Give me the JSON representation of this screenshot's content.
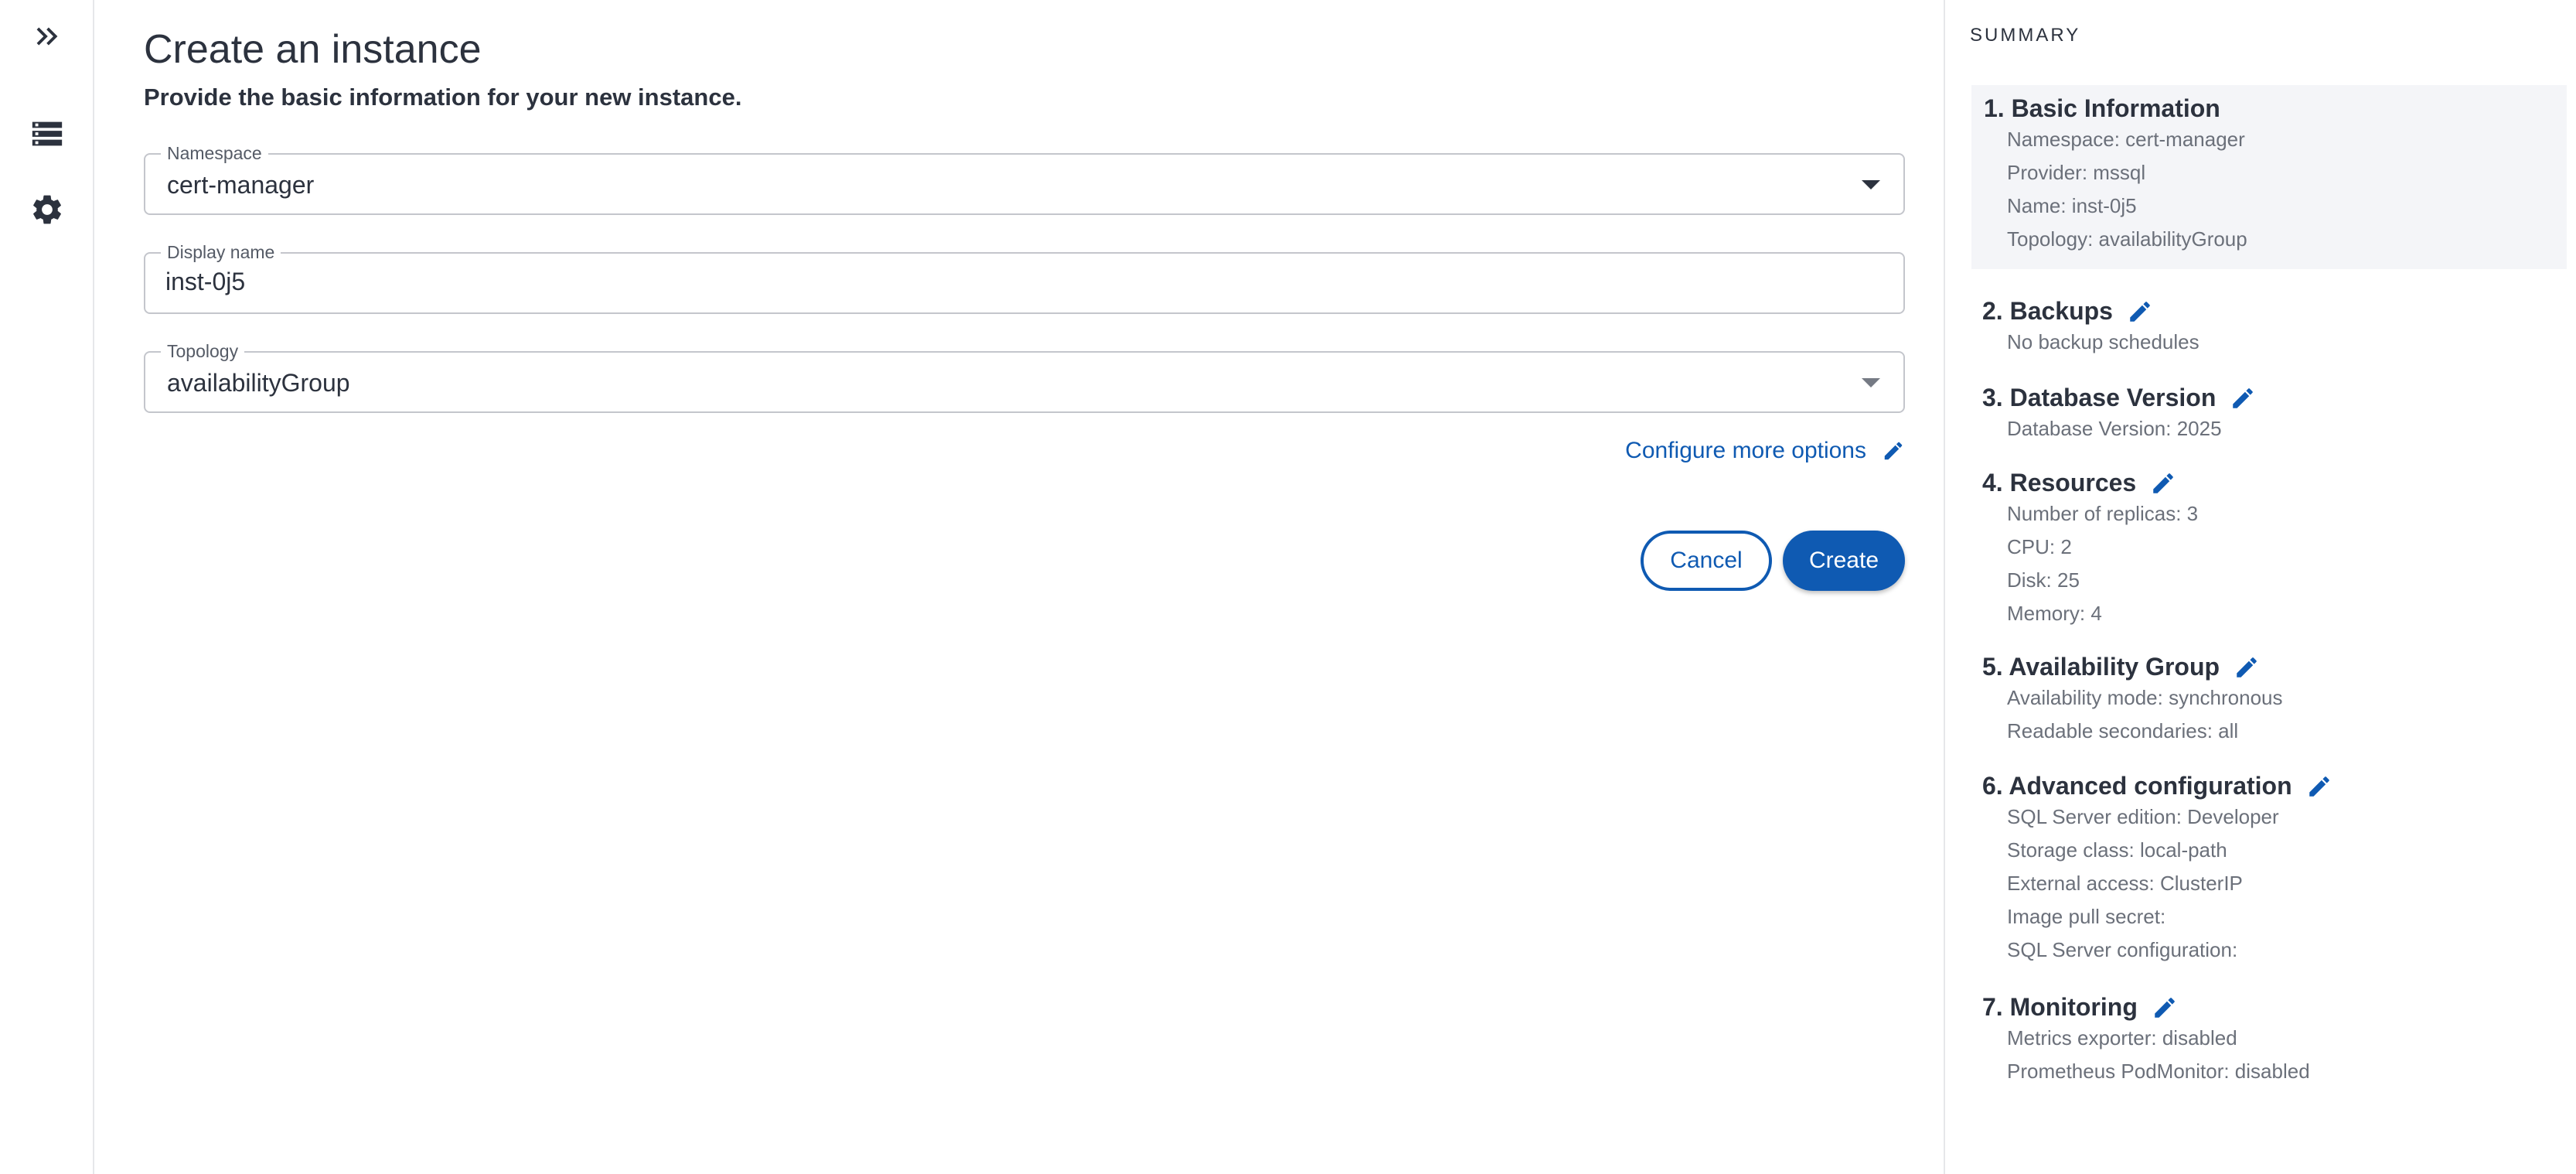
{
  "rail": {
    "icons": [
      "expand-icon",
      "list-icon",
      "gear-icon"
    ]
  },
  "form": {
    "title": "Create an instance",
    "subtitle": "Provide the basic information for your new instance.",
    "namespace": {
      "label": "Namespace",
      "value": "cert-manager"
    },
    "display_name": {
      "label": "Display name",
      "value": "inst-0j5"
    },
    "topology": {
      "label": "Topology",
      "value": "availabilityGroup"
    },
    "more_options_label": "Configure more options",
    "cancel_label": "Cancel",
    "create_label": "Create"
  },
  "summary": {
    "title": "SUMMARY",
    "sections": [
      {
        "title": "1. Basic Information",
        "lines": [
          "Namespace: cert-manager",
          "Provider: mssql",
          "Name: inst-0j5",
          "Topology: availabilityGroup"
        ]
      },
      {
        "title": "2. Backups",
        "lines": [
          "No backup schedules"
        ]
      },
      {
        "title": "3. Database Version",
        "lines": [
          "Database Version: 2025"
        ]
      },
      {
        "title": "4. Resources",
        "lines": [
          "Number of replicas: 3",
          "CPU: 2",
          "Disk: 25",
          "Memory: 4"
        ]
      },
      {
        "title": "5. Availability Group",
        "lines": [
          "Availability mode: synchronous",
          "Readable secondaries: all"
        ]
      },
      {
        "title": "6. Advanced configuration",
        "lines": [
          "SQL Server edition: Developer",
          "Storage class: local-path",
          "External access: ClusterIP",
          "Image pull secret:",
          "SQL Server configuration:"
        ]
      },
      {
        "title": "7. Monitoring",
        "lines": [
          "Metrics exporter: disabled",
          "Prometheus PodMonitor: disabled"
        ]
      }
    ]
  },
  "colors": {
    "accent": "#0f5ab2",
    "text": "#2c323e",
    "muted": "#6b707a",
    "active_section": "#f4f5f8"
  }
}
